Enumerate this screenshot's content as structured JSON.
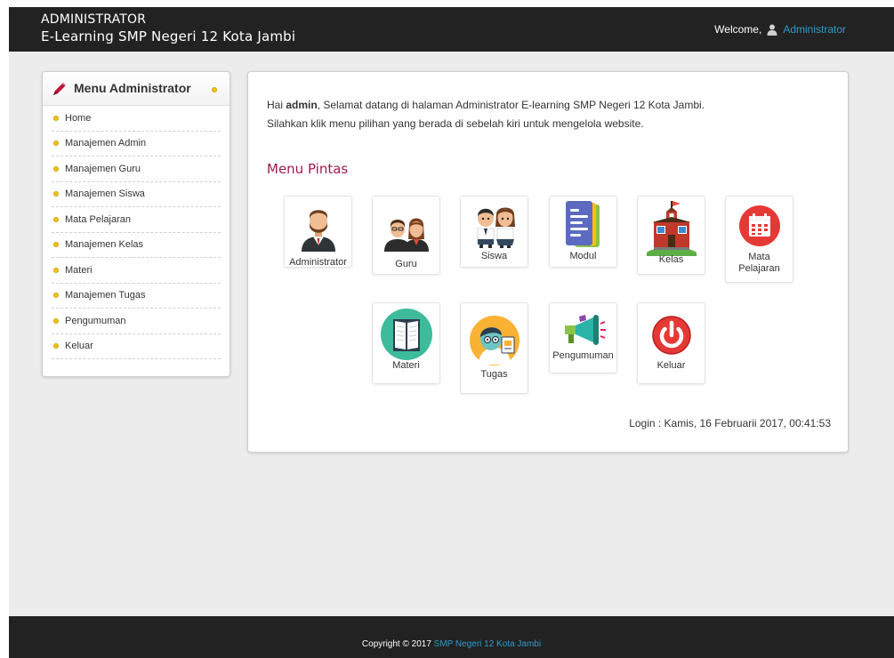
{
  "header": {
    "line1": "ADMINISTRATOR",
    "line2": "E-Learning SMP Negeri 12 Kota Jambi",
    "welcome_label": "Welcome,",
    "user_name": "Administrator"
  },
  "sidebar": {
    "title": "Menu Administrator",
    "items": [
      {
        "label": "Home"
      },
      {
        "label": "Manajemen Admin"
      },
      {
        "label": "Manajemen Guru"
      },
      {
        "label": "Manajemen Siswa"
      },
      {
        "label": "Mata Pelajaran"
      },
      {
        "label": "Manajemen Kelas"
      },
      {
        "label": "Materi"
      },
      {
        "label": "Manajemen Tugas"
      },
      {
        "label": "Pengumuman"
      },
      {
        "label": "Keluar"
      }
    ]
  },
  "main": {
    "greeting_prefix": "Hai ",
    "greeting_user": "admin",
    "greeting_suffix": ", Selamat datang di halaman Administrator E-learning SMP Negeri 12 Kota Jambi.",
    "instruction": "Silahkan klik menu pilihan yang berada di sebelah kiri untuk mengelola website.",
    "shortcut_title": "Menu Pintas",
    "shortcuts": [
      {
        "label": "Administrator",
        "icon": "administrator-icon"
      },
      {
        "label": "Guru",
        "icon": "teachers-icon"
      },
      {
        "label": "Siswa",
        "icon": "students-icon"
      },
      {
        "label": "Modul",
        "icon": "document-icon"
      },
      {
        "label": "Kelas",
        "icon": "school-building-icon"
      },
      {
        "label": "Mata Pelajaran",
        "icon": "calendar-icon"
      },
      {
        "label": "Materi",
        "icon": "book-icon"
      },
      {
        "label": "Tugas",
        "icon": "student-assignment-icon"
      },
      {
        "label": "Pengumuman",
        "icon": "megaphone-icon"
      },
      {
        "label": "Keluar",
        "icon": "power-icon"
      }
    ],
    "login_time": "Login : Kamis, 16 Februarii 2017, 00:41:53"
  },
  "footer": {
    "copyright": "Copyright © 2017 ",
    "school_link": "SMP Negeri 12 Kota Jambi"
  },
  "colors": {
    "topbar": "#222222",
    "link": "#2e9cc8",
    "menu_title": "#9b1d4a",
    "bullet": "#f0c419",
    "background": "#ececec"
  }
}
